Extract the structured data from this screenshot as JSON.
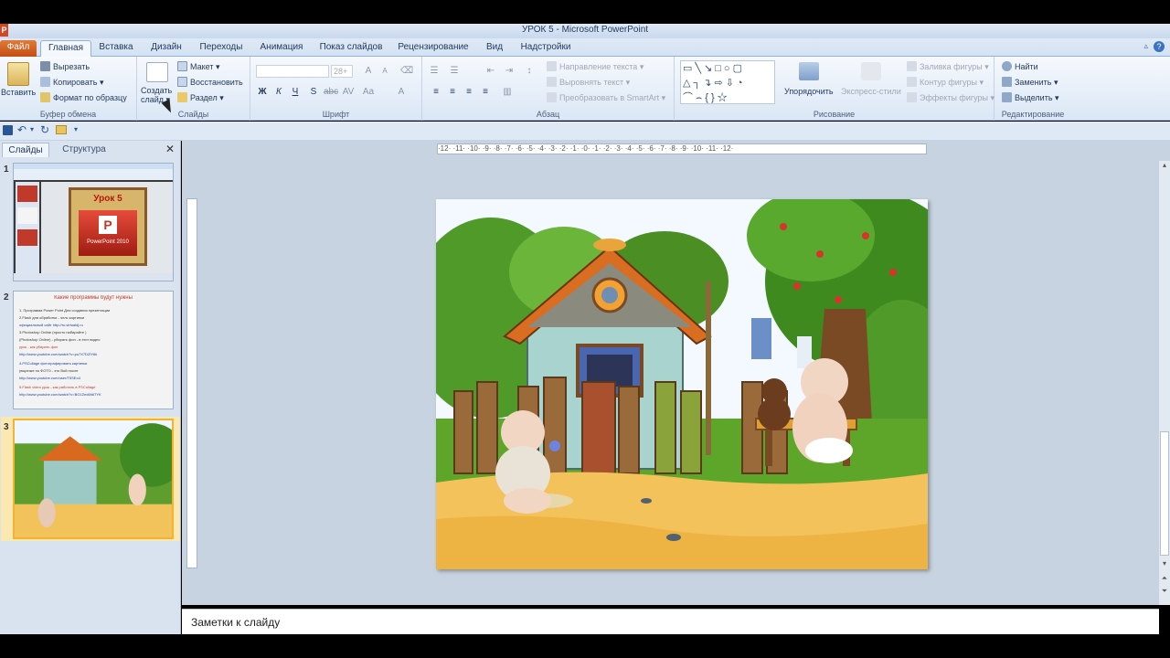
{
  "window": {
    "title": "УРОК 5  -  Microsoft PowerPoint",
    "app_icon_letter": "P"
  },
  "tabs": [
    "Файл",
    "Главная",
    "Вставка",
    "Дизайн",
    "Переходы",
    "Анимация",
    "Показ слайдов",
    "Рецензирование",
    "Вид",
    "Надстройки"
  ],
  "ribbon": {
    "clipboard": {
      "paste": "Вставить",
      "cut": "Вырезать",
      "copy": "Копировать",
      "format_painter": "Формат по образцу",
      "label": "Буфер обмена"
    },
    "slides": {
      "new_slide_line1": "Создать",
      "new_slide_line2": "слайд",
      "layout": "Макет",
      "reset": "Восстановить",
      "section": "Раздел",
      "label": "Слайды"
    },
    "font": {
      "size_placeholder": "28+",
      "label": "Шрифт",
      "bold": "Ж",
      "italic": "К",
      "underline": "Ч",
      "strike": "S",
      "font_color": "A"
    },
    "paragraph": {
      "text_direction": "Направление текста",
      "align_text": "Выровнять текст",
      "smartart": "Преобразовать в SmartArt",
      "label": "Абзац"
    },
    "drawing": {
      "arrange": "Упорядочить",
      "quick_styles": "Экспресс-стили",
      "shape_fill": "Заливка фигуры",
      "shape_outline": "Контур фигуры",
      "shape_effects": "Эффекты фигуры",
      "label": "Рисование"
    },
    "editing": {
      "find": "Найти",
      "replace": "Заменить",
      "select": "Выделить",
      "label": "Редактирование"
    }
  },
  "left_pane": {
    "tab_slides": "Слайды",
    "tab_outline": "Структура",
    "close": "✕",
    "slides": [
      {
        "number": "1",
        "title": "Урок 5",
        "subtitle": "PowerPoint 2010"
      },
      {
        "number": "2",
        "heading": "Какие программы будут нужны",
        "lines": [
          "1. Программа Power Point  Для создания презентации",
          "2.Flash для обработки - эллс картинки",
          "официальный сайт   http://ru.virtualdj.ru",
          "3.Photoshop Online (просто набирайте )",
          "(Photoshop Online)  - убирать фон - в этот видео",
          "урок - как убирать фон",
          "http://www.youtube.com/watch?v=pu7X7DZlY6k",
          "4.PSCollage      фотографировать      картинки",
          "(вырезке по ФОТО - это Вой после",
          "http://www.youtube.com/user/T5SEo4",
          "5.Flash video урок - как работать в PSCollage",
          "http://www.youtube.com/watch?v=BG1Zed6h67YK"
        ]
      },
      {
        "number": "3"
      }
    ]
  },
  "ruler_h": "·12·  ·11·  ·10·  ·9·  ·8·  ·7·  ·6·  ·5·  ·4·  ·3·  ·2·  ·1·  ·0·  ·1·  ·2·  ·3·  ·4·  ·5·  ·6·  ·7·  ·8·  ·9·  ·10·  ·11·  ·12·",
  "notes": {
    "placeholder": "Заметки к слайду"
  },
  "colors": {
    "file_tab": "#d35f1e",
    "ribbon_bg": "#eaf1fb",
    "pane_bg": "#d9e3ef",
    "selection": "#f2b335"
  }
}
